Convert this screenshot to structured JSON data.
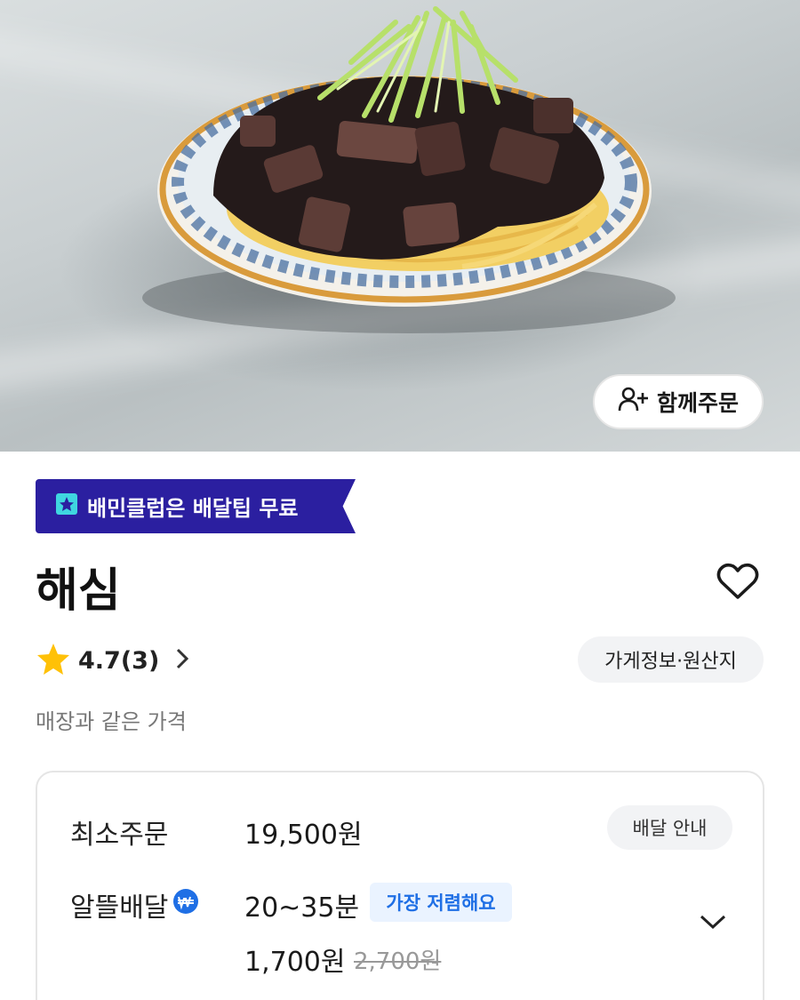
{
  "hero": {
    "image_alt": "짜장면",
    "with_order_label": "함께주문",
    "with_order_icon": "person-add-icon"
  },
  "club_banner": {
    "text": "배민클럽은 배달팁 무료",
    "color": "#2b1fa0",
    "icon": "baemin-club-icon"
  },
  "store": {
    "name": "해심",
    "rating": "4.7(3)",
    "info_button": "가게정보·원산지",
    "price_note": "매장과 같은 가격"
  },
  "delivery": {
    "min_order_label": "최소주문",
    "min_order_value": "19,500원",
    "guide_button": "배달 안내",
    "saver_label": "알뜰배달",
    "saver_time": "20~35분",
    "saver_badge": "가장 저렴해요",
    "saver_fee": "1,700원",
    "saver_fee_original": "2,700원",
    "accent_color": "#1f6fe5"
  }
}
